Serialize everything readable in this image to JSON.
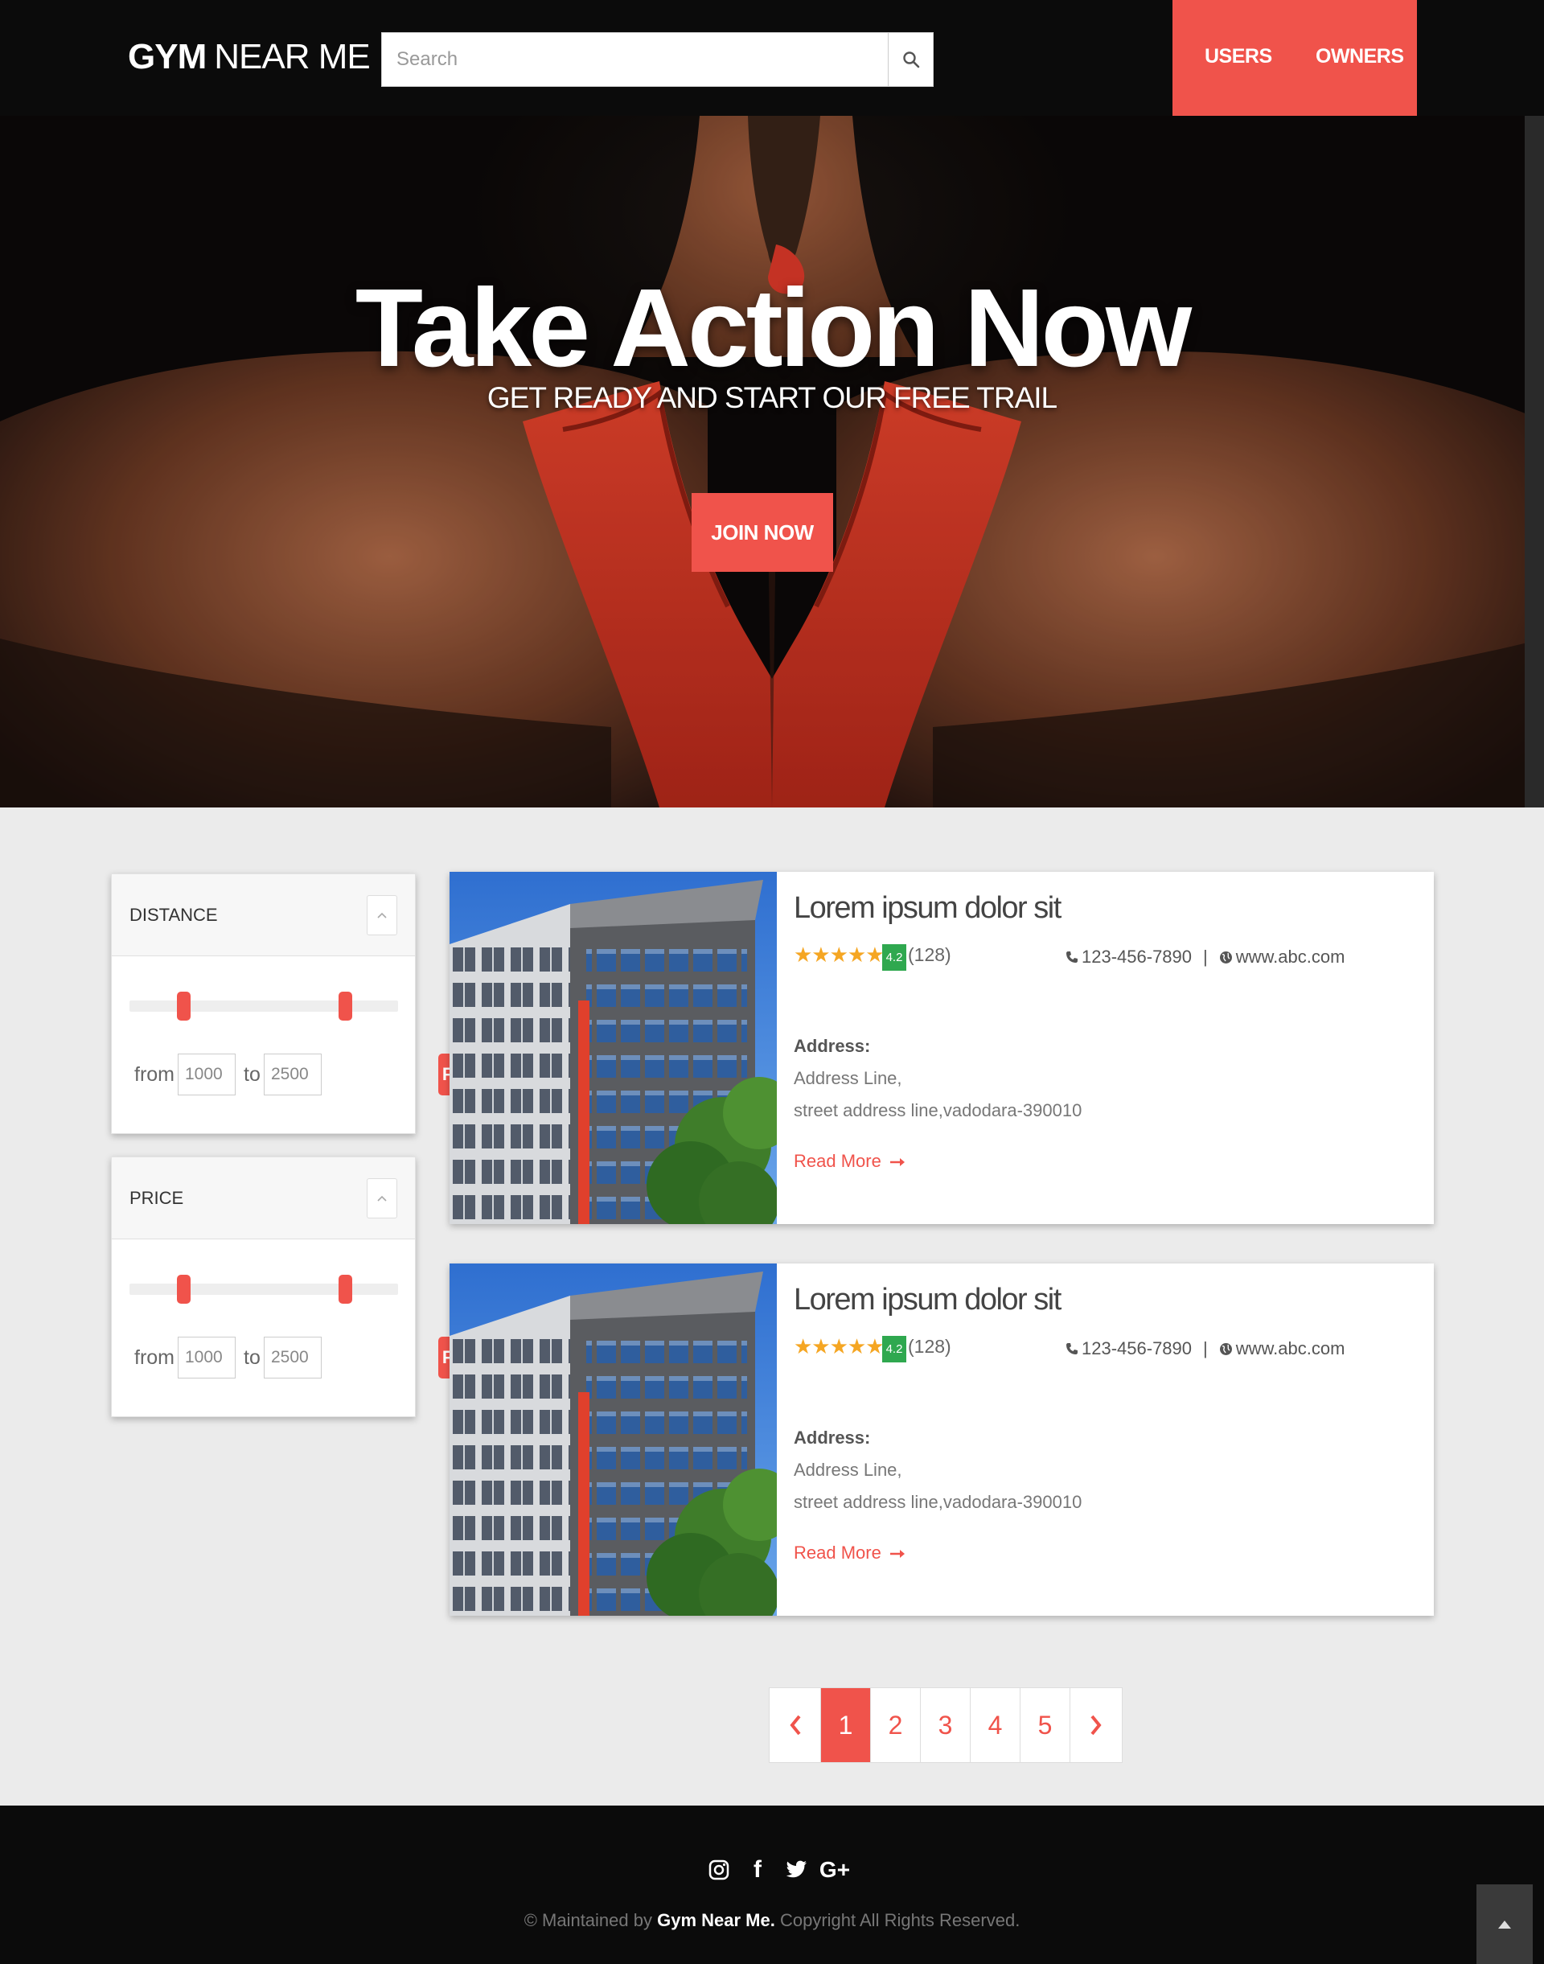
{
  "header": {
    "logo_bold": "GYM",
    "logo_light": "NEAR ME",
    "search_placeholder": "Search",
    "nav": [
      "USERS",
      "OWNERS"
    ]
  },
  "hero": {
    "title": "Take Action Now",
    "subtitle": "GET READY AND START OUR FREE TRAIL",
    "cta": "JOIN NOW"
  },
  "filters": [
    {
      "title": "DISTANCE",
      "from_label": "from",
      "to_label": "to",
      "from_value": "1000",
      "to_value": "2500",
      "button": "FILTER"
    },
    {
      "title": "PRICE",
      "from_label": "from",
      "to_label": "to",
      "from_value": "1000",
      "to_value": "2500",
      "button": "FILTER"
    }
  ],
  "listings": [
    {
      "title": "Lorem ipsum dolor sit",
      "stars": "★★★★★",
      "rating": "4.2",
      "reviews": "(128)",
      "phone": "123-456-7890",
      "website": "www.abc.com",
      "address_label": "Address:",
      "address_line1": "Address Line,",
      "address_line2": "street address line,vadodara-390010",
      "read_more": "Read More"
    },
    {
      "title": "Lorem ipsum dolor sit",
      "stars": "★★★★★",
      "rating": "4.2",
      "reviews": "(128)",
      "phone": "123-456-7890",
      "website": "www.abc.com",
      "address_label": "Address:",
      "address_line1": "Address Line,",
      "address_line2": "street address line,vadodara-390010",
      "read_more": "Read More"
    }
  ],
  "pagination": {
    "pages": [
      "1",
      "2",
      "3",
      "4",
      "5"
    ],
    "current": "1"
  },
  "footer": {
    "social_icons": [
      "instagram-icon",
      "facebook-icon",
      "twitter-icon",
      "google-plus-icon"
    ],
    "facebook_glyph": "f",
    "google_plus_glyph": "G+",
    "copyright_prefix": "© Maintained by ",
    "brand": "Gym Near Me.",
    "copyright_suffix": " Copyright All Rights Reserved."
  },
  "colors": {
    "accent": "#f0534b",
    "header_bg": "#0b0b0b",
    "page_bg": "#ebebeb",
    "rating_badge": "#2fa84f",
    "star": "#f5a623"
  }
}
